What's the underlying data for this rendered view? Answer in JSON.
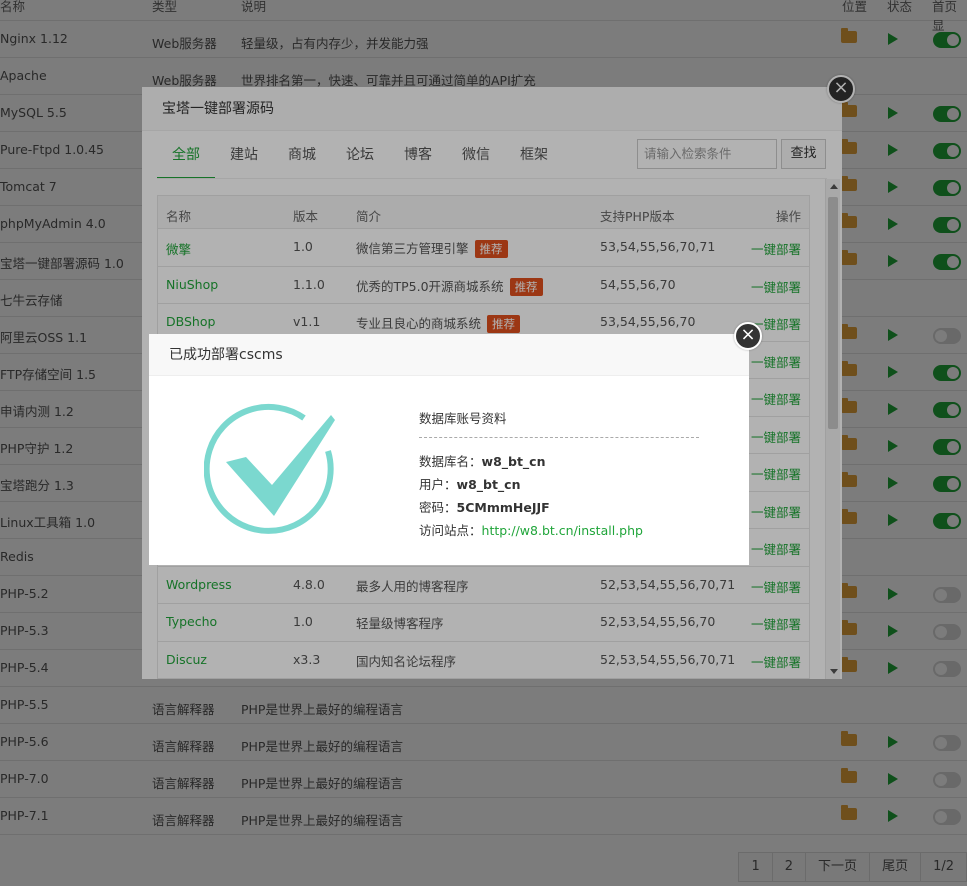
{
  "background": {
    "headers": {
      "name": "名称",
      "type": "类型",
      "desc": "说明",
      "location": "位置",
      "status": "状态",
      "home": "首页显"
    },
    "rows": [
      {
        "name": "Nginx 1.12",
        "type": "Web服务器",
        "desc": "轻量级，占有内存少，并发能力强",
        "folder": true,
        "play": true,
        "toggle": "on"
      },
      {
        "name": "Apache",
        "type": "Web服务器",
        "desc": "世界排名第一，快速、可靠并且可通过简单的API扩充",
        "folder": false,
        "play": false,
        "toggle": ""
      },
      {
        "name": "MySQL 5.5",
        "type": "",
        "desc": "",
        "folder": true,
        "play": true,
        "toggle": "on"
      },
      {
        "name": "Pure-Ftpd 1.0.45",
        "type": "",
        "desc": "",
        "folder": true,
        "play": true,
        "toggle": "on"
      },
      {
        "name": "Tomcat 7",
        "type": "",
        "desc": "",
        "folder": true,
        "play": true,
        "toggle": "on"
      },
      {
        "name": "phpMyAdmin 4.0",
        "type": "",
        "desc": "",
        "folder": true,
        "play": true,
        "toggle": "on"
      },
      {
        "name": "宝塔一键部署源码 1.0",
        "type": "",
        "desc": "",
        "folder": true,
        "play": true,
        "toggle": "on"
      },
      {
        "name": "七牛云存储",
        "type": "",
        "desc": "",
        "folder": false,
        "play": false,
        "toggle": ""
      },
      {
        "name": "阿里云OSS 1.1",
        "type": "",
        "desc": "",
        "folder": true,
        "play": true,
        "toggle": "off"
      },
      {
        "name": "FTP存储空间 1.5",
        "type": "",
        "desc": "",
        "folder": true,
        "play": true,
        "toggle": "on"
      },
      {
        "name": "申请内测 1.2",
        "type": "",
        "desc": "",
        "folder": true,
        "play": true,
        "toggle": "on"
      },
      {
        "name": "PHP守护 1.2",
        "type": "",
        "desc": "",
        "folder": true,
        "play": true,
        "toggle": "on"
      },
      {
        "name": "宝塔跑分 1.3",
        "type": "",
        "desc": "",
        "folder": true,
        "play": true,
        "toggle": "on"
      },
      {
        "name": "Linux工具箱 1.0",
        "type": "",
        "desc": "",
        "folder": true,
        "play": true,
        "toggle": "on"
      },
      {
        "name": "Redis",
        "type": "",
        "desc": "",
        "folder": false,
        "play": false,
        "toggle": ""
      },
      {
        "name": "PHP-5.2",
        "type": "",
        "desc": "",
        "folder": true,
        "play": true,
        "toggle": "off"
      },
      {
        "name": "PHP-5.3",
        "type": "",
        "desc": "",
        "folder": true,
        "play": true,
        "toggle": "off"
      },
      {
        "name": "PHP-5.4",
        "type": "",
        "desc": "",
        "folder": true,
        "play": true,
        "toggle": "off"
      },
      {
        "name": "PHP-5.5",
        "type": "语言解释器",
        "desc": "PHP是世界上最好的编程语言",
        "folder": false,
        "play": false,
        "toggle": ""
      },
      {
        "name": "PHP-5.6",
        "type": "语言解释器",
        "desc": "PHP是世界上最好的编程语言",
        "folder": true,
        "play": true,
        "toggle": "off"
      },
      {
        "name": "PHP-7.0",
        "type": "语言解释器",
        "desc": "PHP是世界上最好的编程语言",
        "folder": true,
        "play": true,
        "toggle": "off"
      },
      {
        "name": "PHP-7.1",
        "type": "语言解释器",
        "desc": "PHP是世界上最好的编程语言",
        "folder": true,
        "play": true,
        "toggle": "off"
      }
    ],
    "pager": [
      "1",
      "2",
      "下一页",
      "尾页",
      "1/2"
    ]
  },
  "deploy_dialog": {
    "title": "宝塔一键部署源码",
    "close": "×",
    "tabs": [
      "全部",
      "建站",
      "商城",
      "论坛",
      "博客",
      "微信",
      "框架"
    ],
    "search_placeholder": "请输入检索条件",
    "search_button": "查找",
    "columns": {
      "name": "名称",
      "version": "版本",
      "intro": "简介",
      "php": "支持PHP版本",
      "action": "操作"
    },
    "rows": [
      {
        "name": "微擎",
        "version": "1.0",
        "intro": "微信第三方管理引擎",
        "badge": "推荐",
        "php": "53,54,55,56,70,71",
        "action": "一键部署"
      },
      {
        "name": "NiuShop",
        "version": "1.1.0",
        "intro": "优秀的TP5.0开源商城系统",
        "badge": "推荐",
        "php": "54,55,56,70",
        "action": "一键部署"
      },
      {
        "name": "DBShop",
        "version": "v1.1",
        "intro": "专业且良心的商城系统",
        "badge": "推荐",
        "php": "53,54,55,56,70",
        "action": "一键部署"
      },
      {
        "name": "",
        "version": "",
        "intro": "",
        "badge": "",
        "php": "",
        "action": "一键部署"
      },
      {
        "name": "",
        "version": "",
        "intro": "",
        "badge": "",
        "php": "",
        "action": "一键部署"
      },
      {
        "name": "",
        "version": "",
        "intro": "",
        "badge": "",
        "php": "",
        "action": "一键部署"
      },
      {
        "name": "",
        "version": "",
        "intro": "",
        "badge": "",
        "php": "",
        "action": "一键部署"
      },
      {
        "name": "",
        "version": "",
        "intro": "",
        "badge": "",
        "php": "",
        "action": "一键部署"
      },
      {
        "name": "",
        "version": "",
        "intro": "",
        "badge": "",
        "php": "",
        "action": "一键部署"
      },
      {
        "name": "Wordpress",
        "version": "4.8.0",
        "intro": "最多人用的博客程序",
        "badge": "",
        "php": "52,53,54,55,56,70,71",
        "action": "一键部署"
      },
      {
        "name": "Typecho",
        "version": "1.0",
        "intro": "轻量级博客程序",
        "badge": "",
        "php": "52,53,54,55,56,70",
        "action": "一键部署"
      },
      {
        "name": "Discuz",
        "version": "x3.3",
        "intro": "国内知名论坛程序",
        "badge": "",
        "php": "52,53,54,55,56,70,71",
        "action": "一键部署"
      }
    ]
  },
  "success_dialog": {
    "title": "已成功部署cscms",
    "close": "×",
    "info_title": "数据库账号资料",
    "db_name_label": "数据库名：",
    "db_name": "w8_bt_cn",
    "user_label": "用户：",
    "user": "w8_bt_cn",
    "password_label": "密码：",
    "password": "5CMmmHeJJF",
    "site_label": "访问站点：",
    "site_url": "http://w8.bt.cn/install.php"
  },
  "colors": {
    "accent": "#20a53a",
    "badge": "#e0501d",
    "check": "#7bd8cf",
    "folder": "#e6a23c"
  }
}
